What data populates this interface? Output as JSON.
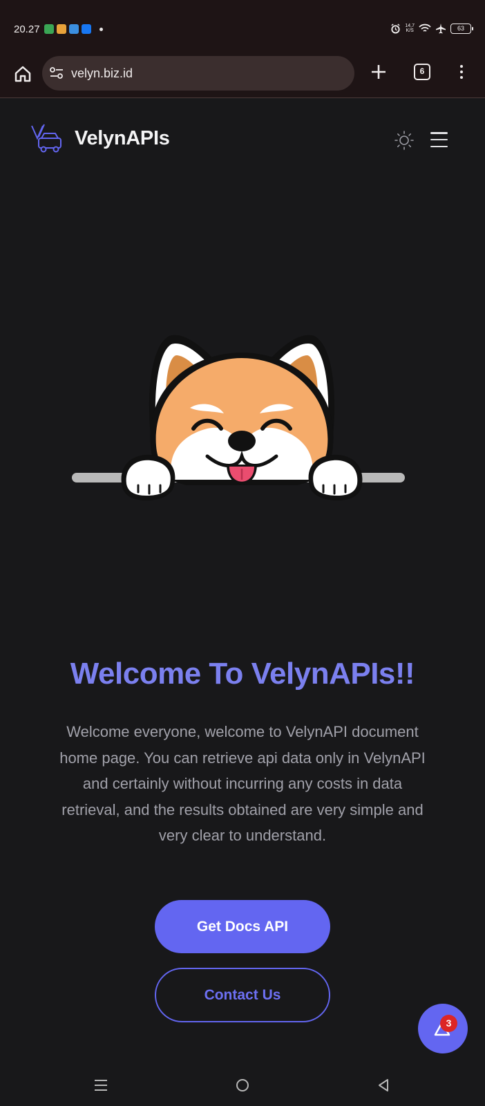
{
  "status_bar": {
    "time": "20.27",
    "net_speed_top": "14,7",
    "net_speed_bottom": "K/S",
    "battery": "63",
    "notification_colors": [
      "#3aa655",
      "#e8a23a",
      "#3b8fe0",
      "#1877f2"
    ]
  },
  "browser": {
    "url": "velyn.biz.id",
    "tab_count": "6"
  },
  "header": {
    "title": "VelynAPIs"
  },
  "hero": {
    "title": "Welcome To VelynAPIs!!",
    "description": "Welcome everyone, welcome to VelynAPI document home page. You can retrieve api data only in VelynAPI and certainly without incurring any costs in data retrieval, and the results obtained are very simple and very clear to understand.",
    "primary_button": "Get Docs API",
    "secondary_button": "Contact Us"
  },
  "fab": {
    "badge_count": "3"
  },
  "colors": {
    "accent": "#6366f1",
    "title": "#7b80ef",
    "background": "#18181a"
  }
}
